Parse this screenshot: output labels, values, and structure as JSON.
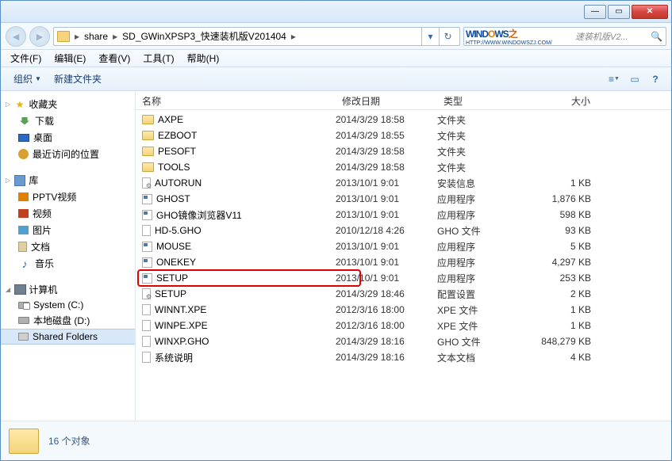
{
  "breadcrumb": {
    "seg1": "share",
    "seg2": "SD_GWinXPSP3_快速装机版V201404"
  },
  "search": {
    "logo_a": "WIND",
    "logo_b": "O",
    "logo_c": "WS",
    "logo_d": "之",
    "sub": "HTTP://WWW.WINDOWSZJ.COM/",
    "placeholder": "速装机版V2..."
  },
  "menu": {
    "file": "文件(F)",
    "edit": "编辑(E)",
    "view": "查看(V)",
    "tools": "工具(T)",
    "help": "帮助(H)"
  },
  "toolbar": {
    "organize": "组织",
    "newfolder": "新建文件夹"
  },
  "columns": {
    "name": "名称",
    "date": "修改日期",
    "type": "类型",
    "size": "大小"
  },
  "sidebar": {
    "fav": "收藏夹",
    "downloads": "下载",
    "desktop": "桌面",
    "recent": "最近访问的位置",
    "lib": "库",
    "pptv": "PPTV视频",
    "video": "视频",
    "pic": "图片",
    "doc": "文档",
    "music": "音乐",
    "comp": "计算机",
    "sysc": "System (C:)",
    "locald": "本地磁盘 (D:)",
    "shared": "Shared Folders"
  },
  "files": [
    {
      "icon": "folder",
      "name": "AXPE",
      "date": "2014/3/29 18:58",
      "type": "文件夹",
      "size": ""
    },
    {
      "icon": "folder",
      "name": "EZBOOT",
      "date": "2014/3/29 18:55",
      "type": "文件夹",
      "size": ""
    },
    {
      "icon": "folder",
      "name": "PESOFT",
      "date": "2014/3/29 18:58",
      "type": "文件夹",
      "size": ""
    },
    {
      "icon": "folder",
      "name": "TOOLS",
      "date": "2014/3/29 18:58",
      "type": "文件夹",
      "size": ""
    },
    {
      "icon": "ini",
      "name": "AUTORUN",
      "date": "2013/10/1 9:01",
      "type": "安装信息",
      "size": "1 KB"
    },
    {
      "icon": "exe",
      "name": "GHOST",
      "date": "2013/10/1 9:01",
      "type": "应用程序",
      "size": "1,876 KB"
    },
    {
      "icon": "exe",
      "name": "GHO镜像浏览器V11",
      "date": "2013/10/1 9:01",
      "type": "应用程序",
      "size": "598 KB"
    },
    {
      "icon": "file",
      "name": "HD-5.GHO",
      "date": "2010/12/18 4:26",
      "type": "GHO 文件",
      "size": "93 KB"
    },
    {
      "icon": "exe",
      "name": "MOUSE",
      "date": "2013/10/1 9:01",
      "type": "应用程序",
      "size": "5 KB"
    },
    {
      "icon": "exe",
      "name": "ONEKEY",
      "date": "2013/10/1 9:01",
      "type": "应用程序",
      "size": "4,297 KB"
    },
    {
      "icon": "exe",
      "name": "SETUP",
      "date": "2013/10/1 9:01",
      "type": "应用程序",
      "size": "253 KB",
      "highlight": true
    },
    {
      "icon": "ini",
      "name": "SETUP",
      "date": "2014/3/29 18:46",
      "type": "配置设置",
      "size": "2 KB"
    },
    {
      "icon": "file",
      "name": "WINNT.XPE",
      "date": "2012/3/16 18:00",
      "type": "XPE 文件",
      "size": "1 KB"
    },
    {
      "icon": "file",
      "name": "WINPE.XPE",
      "date": "2012/3/16 18:00",
      "type": "XPE 文件",
      "size": "1 KB"
    },
    {
      "icon": "file",
      "name": "WINXP.GHO",
      "date": "2014/3/29 18:16",
      "type": "GHO 文件",
      "size": "848,279 KB"
    },
    {
      "icon": "file",
      "name": "系统说明",
      "date": "2014/3/29 18:16",
      "type": "文本文档",
      "size": "4 KB"
    }
  ],
  "status": {
    "count": "16 个对象"
  }
}
